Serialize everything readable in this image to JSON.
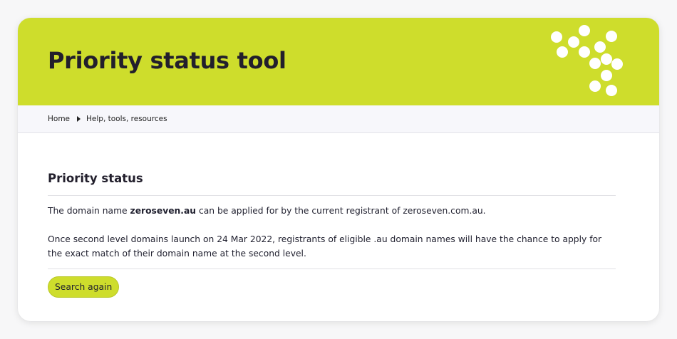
{
  "colors": {
    "accent": "#cedd2c",
    "heading": "#221f2c",
    "breadcrumb_bg": "#f7f7fb"
  },
  "hero": {
    "title": "Priority status tool",
    "decoration_icon": "dot-pattern-icon"
  },
  "breadcrumb": {
    "items": [
      "Home",
      "Help, tools, resources"
    ],
    "separator_icon": "caret-right-icon"
  },
  "main": {
    "heading": "Priority status",
    "result_prefix": "The domain name ",
    "domain": "zeroseven.au",
    "result_suffix": " can be applied for by the current registrant of zeroseven.com.au.",
    "info": "Once second level domains launch on 24 Mar 2022, registrants of eligible .au domain names will have the chance to apply for the exact match of their domain name at the second level.",
    "search_again_label": "Search again"
  }
}
